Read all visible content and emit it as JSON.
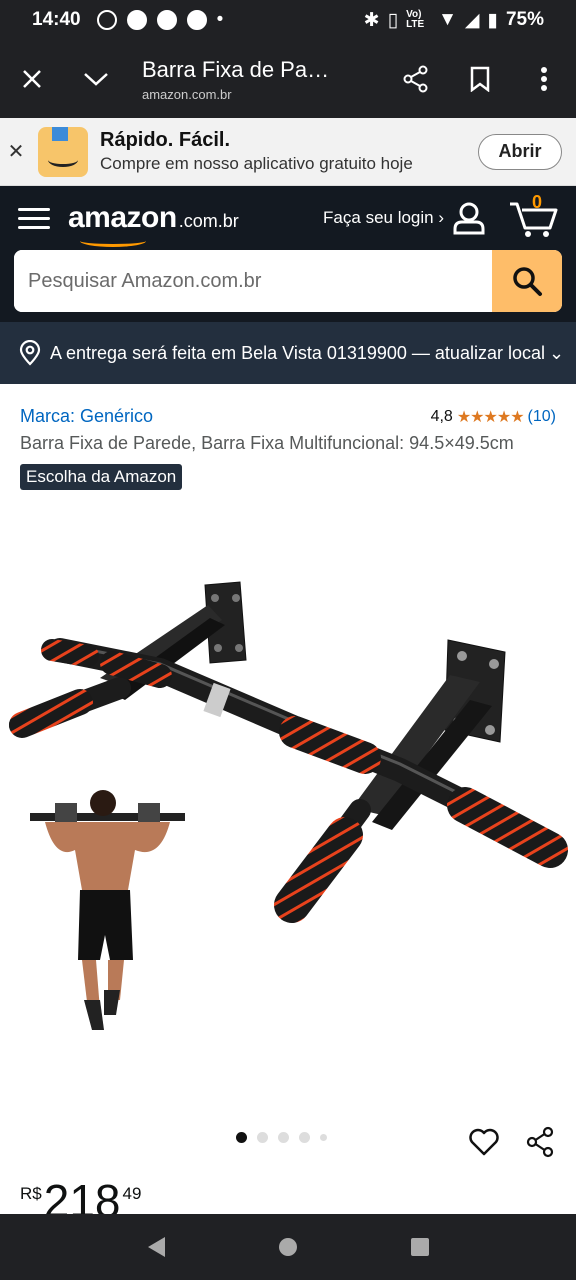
{
  "status_bar": {
    "time": "14:40",
    "battery": "75%",
    "network": "Vo) LTE"
  },
  "browser": {
    "page_title": "Barra Fixa de Parede, Barra Fixa Multifuncional",
    "url": "amazon.com.br"
  },
  "app_banner": {
    "title": "Rápido. Fácil.",
    "subtitle": "Compre em nosso aplicativo gratuito hoje",
    "open_label": "Abrir"
  },
  "header": {
    "logo": "amazon",
    "tld": ".com.br",
    "login_label": "Faça seu login ›",
    "cart_count": "0",
    "search_placeholder": "Pesquisar Amazon.com.br"
  },
  "delivery": {
    "text": "A entrega será feita em Bela Vista 01319900 — atualizar local"
  },
  "product": {
    "brand": "Marca: Genérico",
    "rating_value": "4,8",
    "stars": "★★★★★",
    "rating_count": "(10)",
    "title": "Barra Fixa de Parede, Barra Fixa Multifuncional: 94.5×49.5cm",
    "badge": "Escolha da Amazon",
    "price_currency": "R$",
    "price_whole": "218",
    "price_cents": "49",
    "image_count": 5,
    "active_image": 1
  },
  "colors": {
    "amazon_dark": "#131921",
    "amazon_nav": "#232f3e",
    "search_button": "#febd69",
    "link_blue": "#0066c0",
    "star_orange": "#de7921",
    "accent_orange": "#ff9900",
    "grip_red": "#e8421c"
  }
}
